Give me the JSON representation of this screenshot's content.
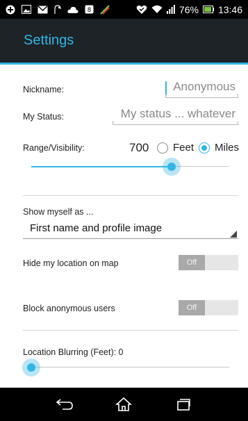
{
  "status_bar": {
    "battery": "76%",
    "time": "13:46",
    "left_icons": [
      "notification-icon",
      "photo-icon",
      "gmail-icon",
      "shaped-icon",
      "cloud-icon",
      "square-icon",
      "leaf-icon"
    ],
    "right_icons": [
      "heart-icon",
      "wifi-icon",
      "signal-icon",
      "battery-icon"
    ]
  },
  "action_bar": {
    "title": "Settings"
  },
  "settings": {
    "nickname": {
      "label": "Nickname:",
      "placeholder": "Anonymous"
    },
    "status": {
      "label": "My Status:",
      "placeholder": "My status ... whatever"
    },
    "range": {
      "label": "Range/Visibility:",
      "value": "700",
      "unit_options": [
        "Feet",
        "Miles"
      ],
      "selected_unit": "Miles",
      "slider_fraction": 0.71
    },
    "show_myself": {
      "label": "Show myself as ...",
      "selected": "First name and profile image"
    },
    "hide_location": {
      "label": "Hide my location on map",
      "toggle": "Off"
    },
    "block_anonymous": {
      "label": "Block anonymous users",
      "toggle": "Off"
    },
    "blurring": {
      "label": "Location Blurring (Feet): 0",
      "slider_fraction": 0.0
    }
  },
  "nav_bar": {
    "buttons": [
      "back-icon",
      "home-icon",
      "recent-apps-icon"
    ]
  },
  "colors": {
    "accent": "#33b5e5",
    "action_bar": "#1d2327",
    "background": "#ffffff"
  }
}
